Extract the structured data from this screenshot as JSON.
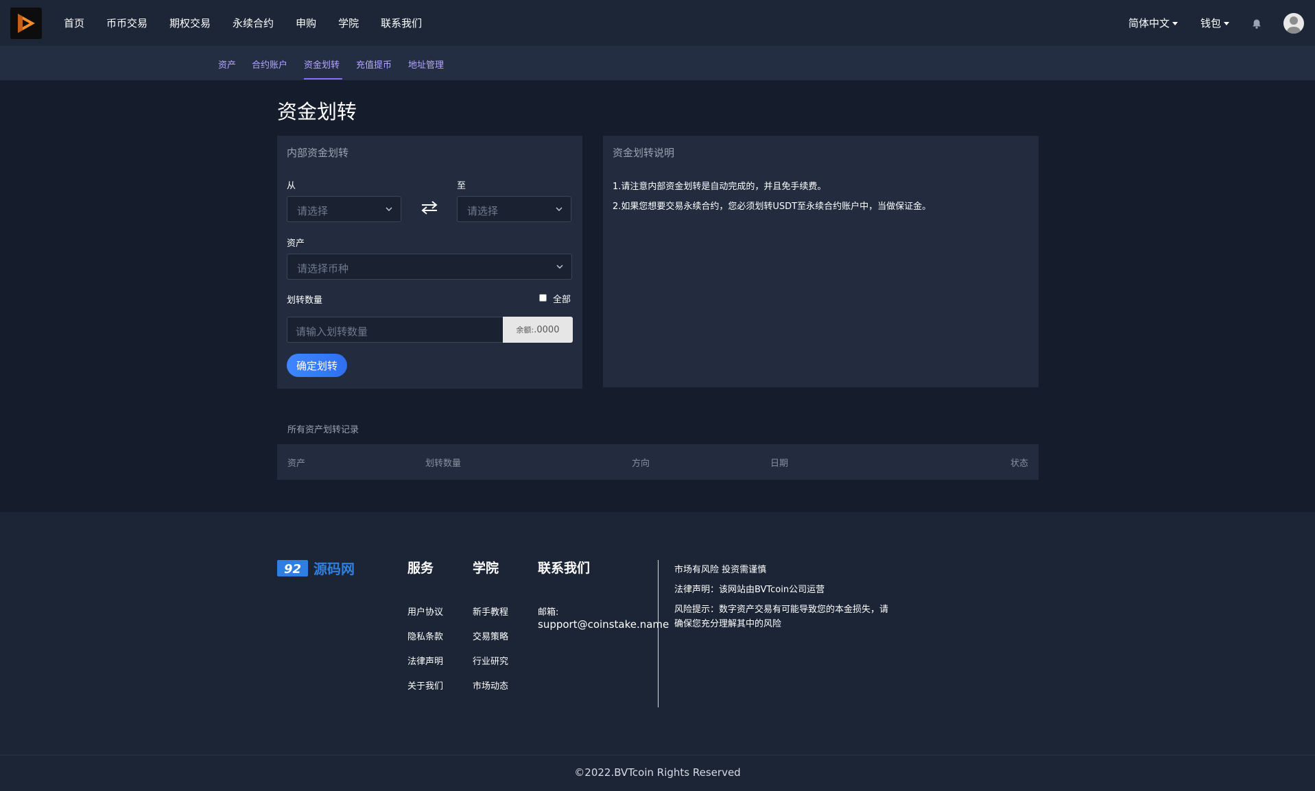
{
  "nav": {
    "items": [
      "首页",
      "币币交易",
      "期权交易",
      "永续合约",
      "申购",
      "学院",
      "联系我们"
    ],
    "language": "简体中文",
    "wallet": "钱包"
  },
  "subnav": {
    "items": [
      "资产",
      "合约账户",
      "资金划转",
      "充值提币",
      "地址管理"
    ],
    "active": "资金划转"
  },
  "page_title": "资金划转",
  "transfer": {
    "title": "内部资金划转",
    "from_label": "从",
    "to_label": "至",
    "from_placeholder": "请选择",
    "to_placeholder": "请选择",
    "asset_label": "资产",
    "asset_placeholder": "请选择币种",
    "amount_label": "划转数量",
    "all_label": "全部",
    "amount_placeholder": "请输入划转数量",
    "balance_label": "余额:",
    "balance_value": ".0000",
    "confirm": "确定划转"
  },
  "notes": {
    "title": "资金划转说明",
    "lines": [
      "1.请注意内部资金划转是自动完成的，并且免手续费。",
      "2.如果您想要交易永续合约，您必须划转USDT至永续合约账户中，当做保证金。"
    ]
  },
  "records": {
    "title": "所有资产划转记录",
    "columns": [
      "资产",
      "划转数量",
      "方向",
      "日期",
      "状态"
    ]
  },
  "footer": {
    "brand": "92 源码网",
    "services": {
      "title": "服务",
      "links": [
        "用户协议",
        "隐私条款",
        "法律声明",
        "关于我们"
      ]
    },
    "academy": {
      "title": "学院",
      "links": [
        "新手教程",
        "交易策略",
        "行业研究",
        "市场动态"
      ]
    },
    "contact": {
      "title": "联系我们",
      "email_label": "邮箱:",
      "email": "support@coinstake.name"
    },
    "notes": [
      "市场有风险 投资需谨慎",
      "法律声明：该网站由BVTcoin公司运营",
      "风险提示：数字资产交易有可能导致您的本金损失，请",
      "确保您充分理解其中的风险"
    ],
    "copyright": "©2022.BVTcoin Rights Reserved"
  },
  "colors": {
    "background": "#151d2c",
    "panel": "#222c3e",
    "accent": "#3f86ff",
    "subnav_text": "#b6a6ff"
  }
}
